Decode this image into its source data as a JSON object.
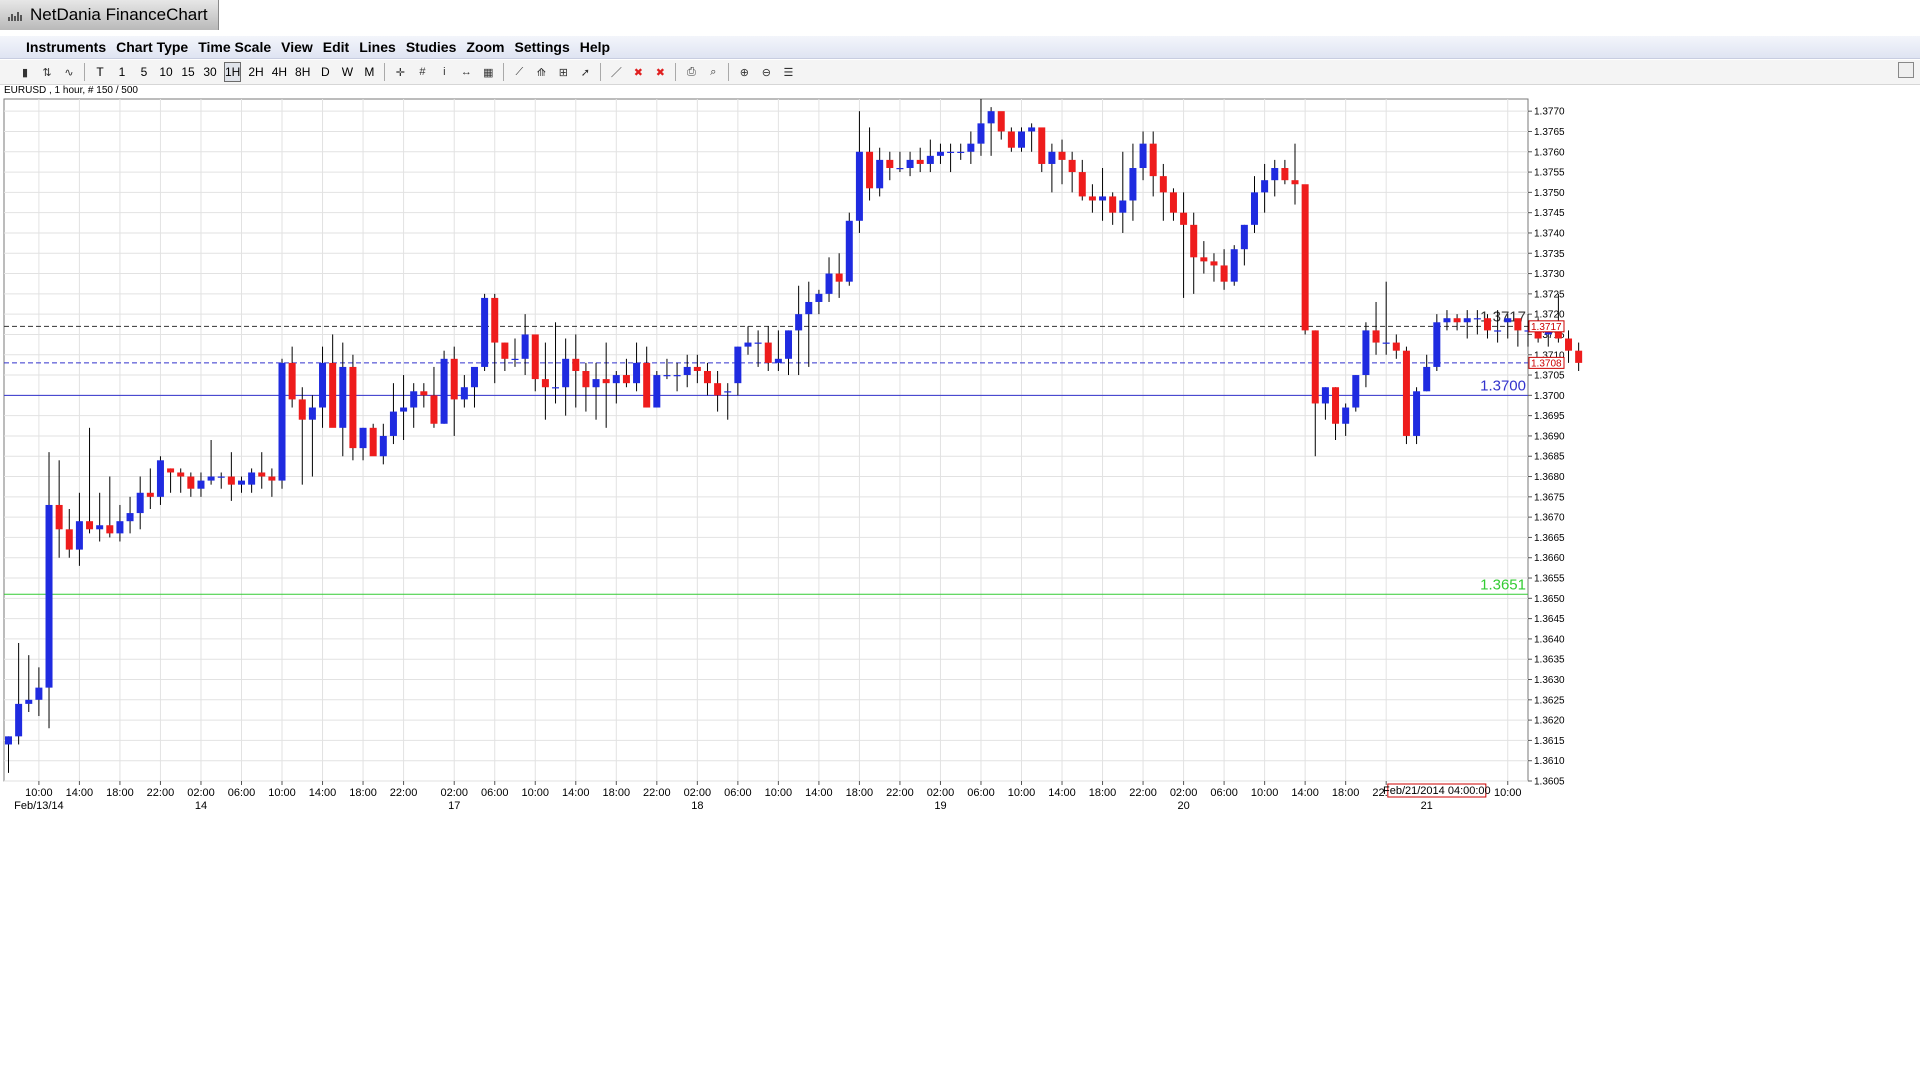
{
  "app": {
    "title": "NetDania FinanceChart"
  },
  "menu": [
    "Instruments",
    "Chart Type",
    "Time Scale",
    "View",
    "Edit",
    "Lines",
    "Studies",
    "Zoom",
    "Settings",
    "Help"
  ],
  "toolbar": {
    "timeframes": [
      "T",
      "1",
      "5",
      "10",
      "15",
      "30",
      "1H",
      "2H",
      "4H",
      "8H",
      "D",
      "W",
      "M"
    ],
    "active_timeframe": "1H",
    "icons": [
      "candles-icon",
      "bars-icon",
      "line-icon",
      "crosshair-icon",
      "grid-icon",
      "info-icon",
      "pan-icon",
      "volume-icon",
      "trendline-icon",
      "fan-icon",
      "fibonacci-icon",
      "cursor-icon",
      "draw-line-icon",
      "delete-icon",
      "delete-all-icon",
      "print-icon",
      "print-preview-icon",
      "zoom-in-icon",
      "zoom-out-icon",
      "fit-icon"
    ]
  },
  "instrument_label": "EURUSD , 1 hour, # 150 / 500",
  "chart_data": {
    "type": "candlestick",
    "ylim": [
      1.3605,
      1.3773
    ],
    "y_ticks": [
      "1.3770",
      "1.3765",
      "1.3760",
      "1.3755",
      "1.3750",
      "1.3745",
      "1.3740",
      "1.3735",
      "1.3730",
      "1.3725",
      "1.3720",
      "1.3715",
      "1.3710",
      "1.3705",
      "1.3700",
      "1.3695",
      "1.3690",
      "1.3685",
      "1.3680",
      "1.3675",
      "1.3670",
      "1.3665",
      "1.3660",
      "1.3655",
      "1.3650",
      "1.3645",
      "1.3640",
      "1.3635",
      "1.3630",
      "1.3625",
      "1.3620",
      "1.3615",
      "1.3610",
      "1.3605"
    ],
    "x_ticks": [
      {
        "i": 3,
        "label": "10:00"
      },
      {
        "i": 7,
        "label": "14:00"
      },
      {
        "i": 11,
        "label": "18:00"
      },
      {
        "i": 15,
        "label": "22:00"
      },
      {
        "i": 19,
        "label": "02:00"
      },
      {
        "i": 23,
        "label": "06:00"
      },
      {
        "i": 27,
        "label": "10:00"
      },
      {
        "i": 31,
        "label": "14:00"
      },
      {
        "i": 35,
        "label": "18:00"
      },
      {
        "i": 39,
        "label": "22:00"
      },
      {
        "i": 44,
        "label": "02:00"
      },
      {
        "i": 48,
        "label": "06:00"
      },
      {
        "i": 52,
        "label": "10:00"
      },
      {
        "i": 56,
        "label": "14:00"
      },
      {
        "i": 60,
        "label": "18:00"
      },
      {
        "i": 64,
        "label": "22:00"
      },
      {
        "i": 68,
        "label": "02:00"
      },
      {
        "i": 72,
        "label": "06:00"
      },
      {
        "i": 76,
        "label": "10:00"
      },
      {
        "i": 80,
        "label": "14:00"
      },
      {
        "i": 84,
        "label": "18:00"
      },
      {
        "i": 88,
        "label": "22:00"
      },
      {
        "i": 92,
        "label": "02:00"
      },
      {
        "i": 96,
        "label": "06:00"
      },
      {
        "i": 100,
        "label": "10:00"
      },
      {
        "i": 104,
        "label": "14:00"
      },
      {
        "i": 108,
        "label": "18:00"
      },
      {
        "i": 112,
        "label": "22:00"
      },
      {
        "i": 116,
        "label": "02:00"
      },
      {
        "i": 120,
        "label": "06:00"
      },
      {
        "i": 124,
        "label": "10:00"
      },
      {
        "i": 128,
        "label": "14:00"
      },
      {
        "i": 132,
        "label": "18:00"
      },
      {
        "i": 136,
        "label": "22:00"
      },
      {
        "i": 148,
        "label": "10:00"
      }
    ],
    "date_labels": [
      {
        "i": 3,
        "label": "Feb/13/14"
      },
      {
        "i": 19,
        "label": "14"
      },
      {
        "i": 44,
        "label": "17"
      },
      {
        "i": 68,
        "label": "18"
      },
      {
        "i": 92,
        "label": "19"
      },
      {
        "i": 116,
        "label": "20"
      },
      {
        "i": 140,
        "label": "21"
      }
    ],
    "cursor_label": {
      "i": 141,
      "label": "Feb/21/2014 04:00:00"
    },
    "levels": [
      {
        "value": 1.3717,
        "label": "1.3717",
        "color": "#333333",
        "style": "dashed",
        "tag": "1.3717"
      },
      {
        "value": 1.3708,
        "label": "",
        "color": "#3333cc",
        "style": "dashed",
        "tag": "1.3708"
      },
      {
        "value": 1.37,
        "label": "1.3700",
        "color": "#3333cc",
        "style": "solid"
      },
      {
        "value": 1.3651,
        "label": "1.3651",
        "color": "#33cc33",
        "style": "solid"
      }
    ],
    "up_color": "#1f2be0",
    "down_color": "#ee1c1c",
    "candles": [
      [
        1.3614,
        1.3616,
        1.3607,
        1.3616
      ],
      [
        1.3616,
        1.3639,
        1.3614,
        1.3624
      ],
      [
        1.3624,
        1.3636,
        1.3622,
        1.3625
      ],
      [
        1.3625,
        1.3633,
        1.3621,
        1.3628
      ],
      [
        1.3628,
        1.3686,
        1.3618,
        1.3673
      ],
      [
        1.3673,
        1.3684,
        1.366,
        1.3667
      ],
      [
        1.3667,
        1.3672,
        1.366,
        1.3662
      ],
      [
        1.3662,
        1.3676,
        1.3658,
        1.3669
      ],
      [
        1.3669,
        1.3692,
        1.3666,
        1.3667
      ],
      [
        1.3667,
        1.3676,
        1.3664,
        1.3668
      ],
      [
        1.3668,
        1.368,
        1.3665,
        1.3666
      ],
      [
        1.3666,
        1.3673,
        1.3664,
        1.3669
      ],
      [
        1.3669,
        1.3675,
        1.3666,
        1.3671
      ],
      [
        1.3671,
        1.368,
        1.3667,
        1.3676
      ],
      [
        1.3676,
        1.3682,
        1.3672,
        1.3675
      ],
      [
        1.3675,
        1.3685,
        1.3673,
        1.3684
      ],
      [
        1.3682,
        1.3682,
        1.3676,
        1.3681
      ],
      [
        1.3681,
        1.3682,
        1.3676,
        1.368
      ],
      [
        1.368,
        1.3681,
        1.3675,
        1.3677
      ],
      [
        1.3677,
        1.3681,
        1.3675,
        1.3679
      ],
      [
        1.3679,
        1.3689,
        1.3678,
        1.368
      ],
      [
        1.368,
        1.3681,
        1.3677,
        1.368
      ],
      [
        1.368,
        1.3686,
        1.3674,
        1.3678
      ],
      [
        1.3678,
        1.368,
        1.3676,
        1.3679
      ],
      [
        1.3678,
        1.3682,
        1.3676,
        1.3681
      ],
      [
        1.3681,
        1.3686,
        1.3677,
        1.368
      ],
      [
        1.368,
        1.3682,
        1.3675,
        1.3679
      ],
      [
        1.3679,
        1.3709,
        1.3677,
        1.3708
      ],
      [
        1.3708,
        1.3712,
        1.3697,
        1.3699
      ],
      [
        1.3699,
        1.3702,
        1.3678,
        1.3694
      ],
      [
        1.3694,
        1.37,
        1.368,
        1.3697
      ],
      [
        1.3697,
        1.3712,
        1.3692,
        1.3708
      ],
      [
        1.3708,
        1.3715,
        1.37,
        1.3692
      ],
      [
        1.3692,
        1.3713,
        1.3685,
        1.3707
      ],
      [
        1.3707,
        1.371,
        1.3684,
        1.3687
      ],
      [
        1.3687,
        1.3692,
        1.3684,
        1.3692
      ],
      [
        1.3692,
        1.3693,
        1.3687,
        1.3685
      ],
      [
        1.3685,
        1.3693,
        1.3683,
        1.369
      ],
      [
        1.369,
        1.3703,
        1.3688,
        1.3696
      ],
      [
        1.3696,
        1.3705,
        1.3689,
        1.3697
      ],
      [
        1.3697,
        1.3703,
        1.3692,
        1.3701
      ],
      [
        1.3701,
        1.3703,
        1.3697,
        1.37
      ],
      [
        1.37,
        1.3707,
        1.3692,
        1.3693
      ],
      [
        1.3693,
        1.3711,
        1.3693,
        1.3709
      ],
      [
        1.3709,
        1.3712,
        1.369,
        1.3699
      ],
      [
        1.3699,
        1.3705,
        1.3697,
        1.3702
      ],
      [
        1.3702,
        1.3705,
        1.3697,
        1.3707
      ],
      [
        1.3707,
        1.3725,
        1.3706,
        1.3724
      ],
      [
        1.3724,
        1.3725,
        1.3703,
        1.3713
      ],
      [
        1.3713,
        1.3713,
        1.3706,
        1.3709
      ],
      [
        1.3709,
        1.3714,
        1.3707,
        1.3709
      ],
      [
        1.3709,
        1.372,
        1.3705,
        1.3715
      ],
      [
        1.3715,
        1.3715,
        1.3701,
        1.3704
      ],
      [
        1.3704,
        1.3713,
        1.3694,
        1.3702
      ],
      [
        1.3702,
        1.3718,
        1.3698,
        1.3702
      ],
      [
        1.3702,
        1.3714,
        1.3695,
        1.3709
      ],
      [
        1.3709,
        1.3715,
        1.3697,
        1.3706
      ],
      [
        1.3706,
        1.3708,
        1.3696,
        1.3702
      ],
      [
        1.3702,
        1.3708,
        1.3694,
        1.3704
      ],
      [
        1.3704,
        1.3713,
        1.3692,
        1.3703
      ],
      [
        1.3703,
        1.3706,
        1.3698,
        1.3705
      ],
      [
        1.3705,
        1.3709,
        1.3702,
        1.3703
      ],
      [
        1.3703,
        1.3713,
        1.3701,
        1.3708
      ],
      [
        1.3708,
        1.3712,
        1.3697,
        1.3697
      ],
      [
        1.3697,
        1.3706,
        1.3697,
        1.3705
      ],
      [
        1.3705,
        1.3709,
        1.3704,
        1.3705
      ],
      [
        1.3705,
        1.3708,
        1.3701,
        1.3705
      ],
      [
        1.3705,
        1.371,
        1.3702,
        1.3707
      ],
      [
        1.3707,
        1.371,
        1.3703,
        1.3706
      ],
      [
        1.3706,
        1.3708,
        1.37,
        1.3703
      ],
      [
        1.3703,
        1.3706,
        1.3696,
        1.37
      ],
      [
        1.3701,
        1.3703,
        1.3694,
        1.3701
      ],
      [
        1.3703,
        1.3712,
        1.37,
        1.3712
      ],
      [
        1.3712,
        1.3717,
        1.371,
        1.3713
      ],
      [
        1.3713,
        1.3716,
        1.3707,
        1.3713
      ],
      [
        1.3713,
        1.3717,
        1.3706,
        1.3708
      ],
      [
        1.3708,
        1.3716,
        1.3706,
        1.3709
      ],
      [
        1.3709,
        1.3716,
        1.3705,
        1.3716
      ],
      [
        1.3716,
        1.3727,
        1.3705,
        1.372
      ],
      [
        1.372,
        1.3728,
        1.3707,
        1.3723
      ],
      [
        1.3723,
        1.3726,
        1.372,
        1.3725
      ],
      [
        1.3725,
        1.3734,
        1.3723,
        1.373
      ],
      [
        1.373,
        1.3735,
        1.3724,
        1.3728
      ],
      [
        1.3728,
        1.3745,
        1.3727,
        1.3743
      ],
      [
        1.3743,
        1.377,
        1.374,
        1.376
      ],
      [
        1.376,
        1.3766,
        1.3748,
        1.3751
      ],
      [
        1.3751,
        1.3761,
        1.3749,
        1.3758
      ],
      [
        1.3758,
        1.376,
        1.3753,
        1.3756
      ],
      [
        1.3756,
        1.376,
        1.3755,
        1.3756
      ],
      [
        1.3756,
        1.376,
        1.3754,
        1.3758
      ],
      [
        1.3758,
        1.3761,
        1.3755,
        1.3757
      ],
      [
        1.3757,
        1.3763,
        1.3755,
        1.3759
      ],
      [
        1.3759,
        1.3762,
        1.3757,
        1.376
      ],
      [
        1.376,
        1.3762,
        1.3755,
        1.376
      ],
      [
        1.376,
        1.3762,
        1.3758,
        1.376
      ],
      [
        1.376,
        1.3765,
        1.3757,
        1.3762
      ],
      [
        1.3762,
        1.3773,
        1.3759,
        1.3767
      ],
      [
        1.3767,
        1.3771,
        1.3759,
        1.377
      ],
      [
        1.377,
        1.3769,
        1.3763,
        1.3765
      ],
      [
        1.3765,
        1.3766,
        1.376,
        1.3761
      ],
      [
        1.3761,
        1.3766,
        1.376,
        1.3765
      ],
      [
        1.3765,
        1.3767,
        1.376,
        1.3766
      ],
      [
        1.3766,
        1.3765,
        1.3755,
        1.3757
      ],
      [
        1.3757,
        1.3762,
        1.375,
        1.376
      ],
      [
        1.376,
        1.3763,
        1.3752,
        1.3758
      ],
      [
        1.3758,
        1.376,
        1.375,
        1.3755
      ],
      [
        1.3755,
        1.3758,
        1.3748,
        1.3749
      ],
      [
        1.3749,
        1.3752,
        1.3745,
        1.3748
      ],
      [
        1.3748,
        1.3756,
        1.3743,
        1.3749
      ],
      [
        1.3749,
        1.375,
        1.3742,
        1.3745
      ],
      [
        1.3745,
        1.376,
        1.374,
        1.3748
      ],
      [
        1.3748,
        1.3762,
        1.3743,
        1.3756
      ],
      [
        1.3756,
        1.3765,
        1.3753,
        1.3762
      ],
      [
        1.3762,
        1.3765,
        1.3749,
        1.3754
      ],
      [
        1.3754,
        1.3757,
        1.3743,
        1.375
      ],
      [
        1.375,
        1.3751,
        1.3743,
        1.3745
      ],
      [
        1.3745,
        1.375,
        1.3724,
        1.3742
      ],
      [
        1.3742,
        1.3745,
        1.3725,
        1.3734
      ],
      [
        1.3734,
        1.3738,
        1.373,
        1.3733
      ],
      [
        1.3733,
        1.3735,
        1.3728,
        1.3732
      ],
      [
        1.3732,
        1.3736,
        1.3726,
        1.3728
      ],
      [
        1.3728,
        1.3737,
        1.3727,
        1.3736
      ],
      [
        1.3736,
        1.3742,
        1.3732,
        1.3742
      ],
      [
        1.3742,
        1.3754,
        1.374,
        1.375
      ],
      [
        1.375,
        1.3757,
        1.3745,
        1.3753
      ],
      [
        1.3753,
        1.3758,
        1.3749,
        1.3756
      ],
      [
        1.3756,
        1.3758,
        1.3752,
        1.3753
      ],
      [
        1.3753,
        1.3762,
        1.3747,
        1.3752
      ],
      [
        1.3752,
        1.3751,
        1.3715,
        1.3716
      ],
      [
        1.3716,
        1.3716,
        1.3685,
        1.3698
      ],
      [
        1.3698,
        1.3702,
        1.3694,
        1.3702
      ],
      [
        1.3702,
        1.3702,
        1.3689,
        1.3693
      ],
      [
        1.3693,
        1.3698,
        1.369,
        1.3697
      ],
      [
        1.3697,
        1.3705,
        1.3696,
        1.3705
      ],
      [
        1.3705,
        1.3718,
        1.3702,
        1.3716
      ],
      [
        1.3716,
        1.3723,
        1.371,
        1.3713
      ],
      [
        1.3713,
        1.3728,
        1.371,
        1.3713
      ],
      [
        1.3713,
        1.3715,
        1.3709,
        1.3711
      ],
      [
        1.3711,
        1.3712,
        1.3688,
        1.369
      ],
      [
        1.369,
        1.3702,
        1.3688,
        1.3701
      ],
      [
        1.3701,
        1.371,
        1.3701,
        1.3707
      ],
      [
        1.3707,
        1.372,
        1.3706,
        1.3718
      ],
      [
        1.3718,
        1.3721,
        1.3716,
        1.3719
      ],
      [
        1.3719,
        1.372,
        1.3716,
        1.3718
      ],
      [
        1.3718,
        1.3721,
        1.3714,
        1.3719
      ],
      [
        1.3719,
        1.3721,
        1.3715,
        1.3719
      ],
      [
        1.3719,
        1.372,
        1.3714,
        1.3716
      ],
      [
        1.3716,
        1.3721,
        1.3713,
        1.3716
      ],
      [
        1.3718,
        1.372,
        1.3714,
        1.3719
      ],
      [
        1.3719,
        1.3718,
        1.3712,
        1.3716
      ],
      [
        1.3716,
        1.372,
        1.3712,
        1.3716
      ],
      [
        1.3716,
        1.3719,
        1.3713,
        1.3714
      ],
      [
        1.3715,
        1.3718,
        1.3712,
        1.3717
      ],
      [
        1.3717,
        1.3725,
        1.3713,
        1.3714
      ],
      [
        1.3714,
        1.3716,
        1.3708,
        1.3711
      ],
      [
        1.3711,
        1.3713,
        1.3706,
        1.3708
      ]
    ]
  }
}
